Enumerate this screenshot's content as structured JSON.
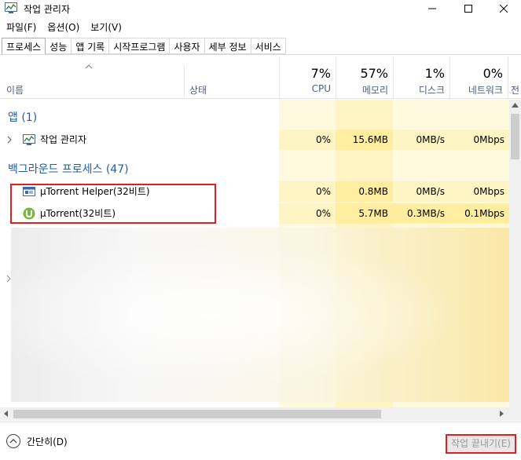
{
  "window": {
    "title": "작업 관리자"
  },
  "menu": [
    "파일(F)",
    "옵션(O)",
    "보기(V)"
  ],
  "tabs": [
    "프로세스",
    "성능",
    "앱 기록",
    "시작프로그램",
    "사용자",
    "세부 정보",
    "서비스"
  ],
  "header": {
    "name": "이름",
    "status": "상태",
    "cpu_pct": "7%",
    "cpu_label": "CPU",
    "mem_pct": "57%",
    "mem_label": "메모리",
    "disk_pct": "1%",
    "disk_label": "디스크",
    "net_pct": "0%",
    "net_label": "네트워크",
    "extra_label": "전"
  },
  "groups": {
    "apps": "앱 (1)",
    "background": "백그라운드 프로세스 (47)"
  },
  "rows": [
    {
      "name": "작업 관리자",
      "cpu": "0%",
      "mem": "15.6MB",
      "disk": "0MB/s",
      "net": "0Mbps",
      "icon": "task-manager-icon"
    },
    {
      "name": "µTorrent Helper(32비트)",
      "cpu": "0%",
      "mem": "0.8MB",
      "disk": "0MB/s",
      "net": "0Mbps",
      "icon": "utorrent-helper-icon"
    },
    {
      "name": "µTorrent(32비트)",
      "cpu": "0%",
      "mem": "5.7MB",
      "disk": "0.3MB/s",
      "net": "0.1Mbps",
      "icon": "utorrent-icon"
    }
  ],
  "footer": {
    "collapse": "간단히(D)",
    "end_task": "작업 끝내기(E)"
  },
  "colors": {
    "accent": "#1e5fa8",
    "highlight": "#e02020",
    "cell_bg": "#fff4c4",
    "cell_bg_light": "#fff9e0"
  }
}
